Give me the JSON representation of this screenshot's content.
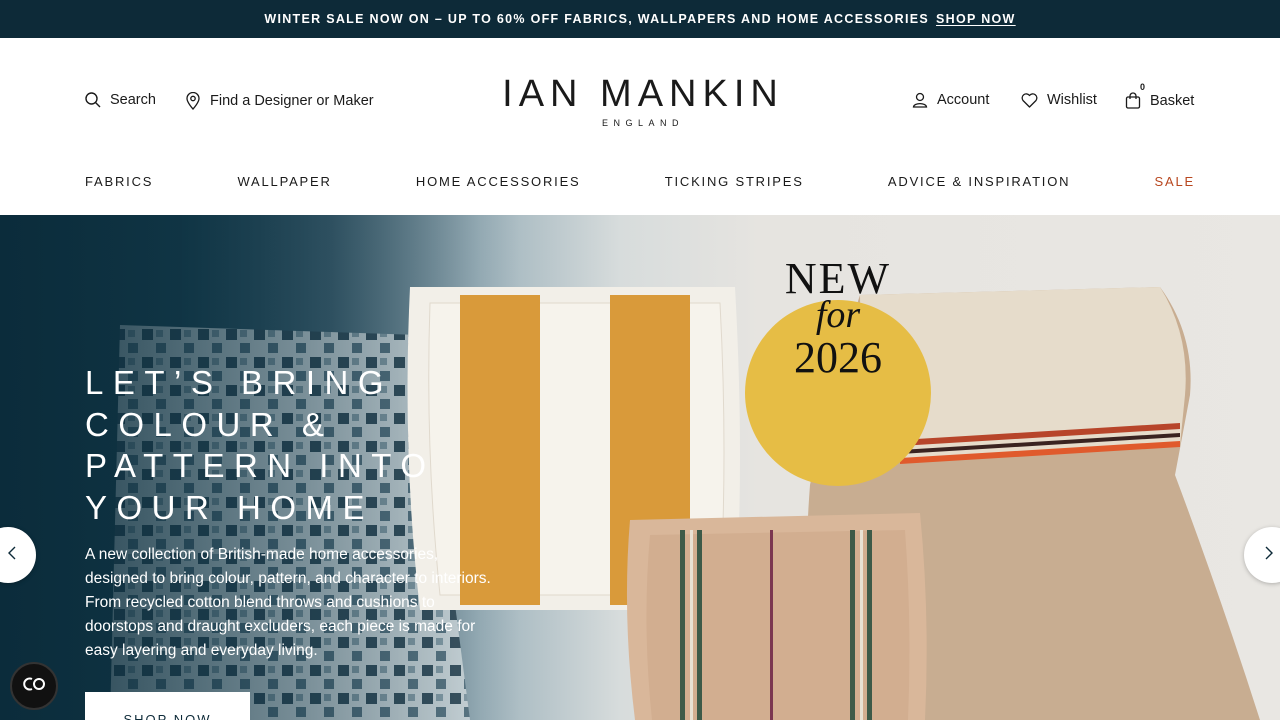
{
  "promo": {
    "text": "WINTER SALE NOW ON – UP TO 60% OFF FABRICS, WALLPAPERS AND HOME ACCESSORIES",
    "link": "SHOP NOW"
  },
  "header": {
    "search_label": "Search",
    "find_label": "Find a Designer or Maker",
    "logo_main": "IAN MANKIN",
    "logo_sub": "ENGLAND",
    "account_label": "Account",
    "wishlist_label": "Wishlist",
    "basket_label": "Basket",
    "basket_count": "0"
  },
  "nav": {
    "items": [
      "FABRICS",
      "WALLPAPER",
      "HOME ACCESSORIES",
      "TICKING STRIPES",
      "ADVICE & INSPIRATION",
      "SALE"
    ]
  },
  "hero": {
    "heading_lines": [
      "LET’S BRING",
      "COLOUR &",
      "PATTERN INTO",
      "YOUR HOME"
    ],
    "body_lines": [
      "A new collection of British-made home accessories,",
      "designed to bring colour, pattern, and character to interiors.",
      "From recycled cotton blend throws and cushions to",
      "doorstops and draught excluders, each piece is made for",
      "easy layering and everyday living."
    ],
    "cta": "SHOP NOW",
    "badge_line1": "NEW",
    "badge_line2": "for",
    "badge_line3": "2026"
  },
  "colors": {
    "promo_bg": "#0d2a38",
    "sale": "#b8471f",
    "badge": "#e6bd45"
  },
  "icons": {
    "search": "search-icon",
    "location": "map-pin-icon",
    "account": "user-icon",
    "wishlist": "heart-icon",
    "basket": "shopping-bag-icon",
    "prev": "chevron-left-icon",
    "next": "chevron-right-icon",
    "cookie": "cookie-settings-icon"
  }
}
